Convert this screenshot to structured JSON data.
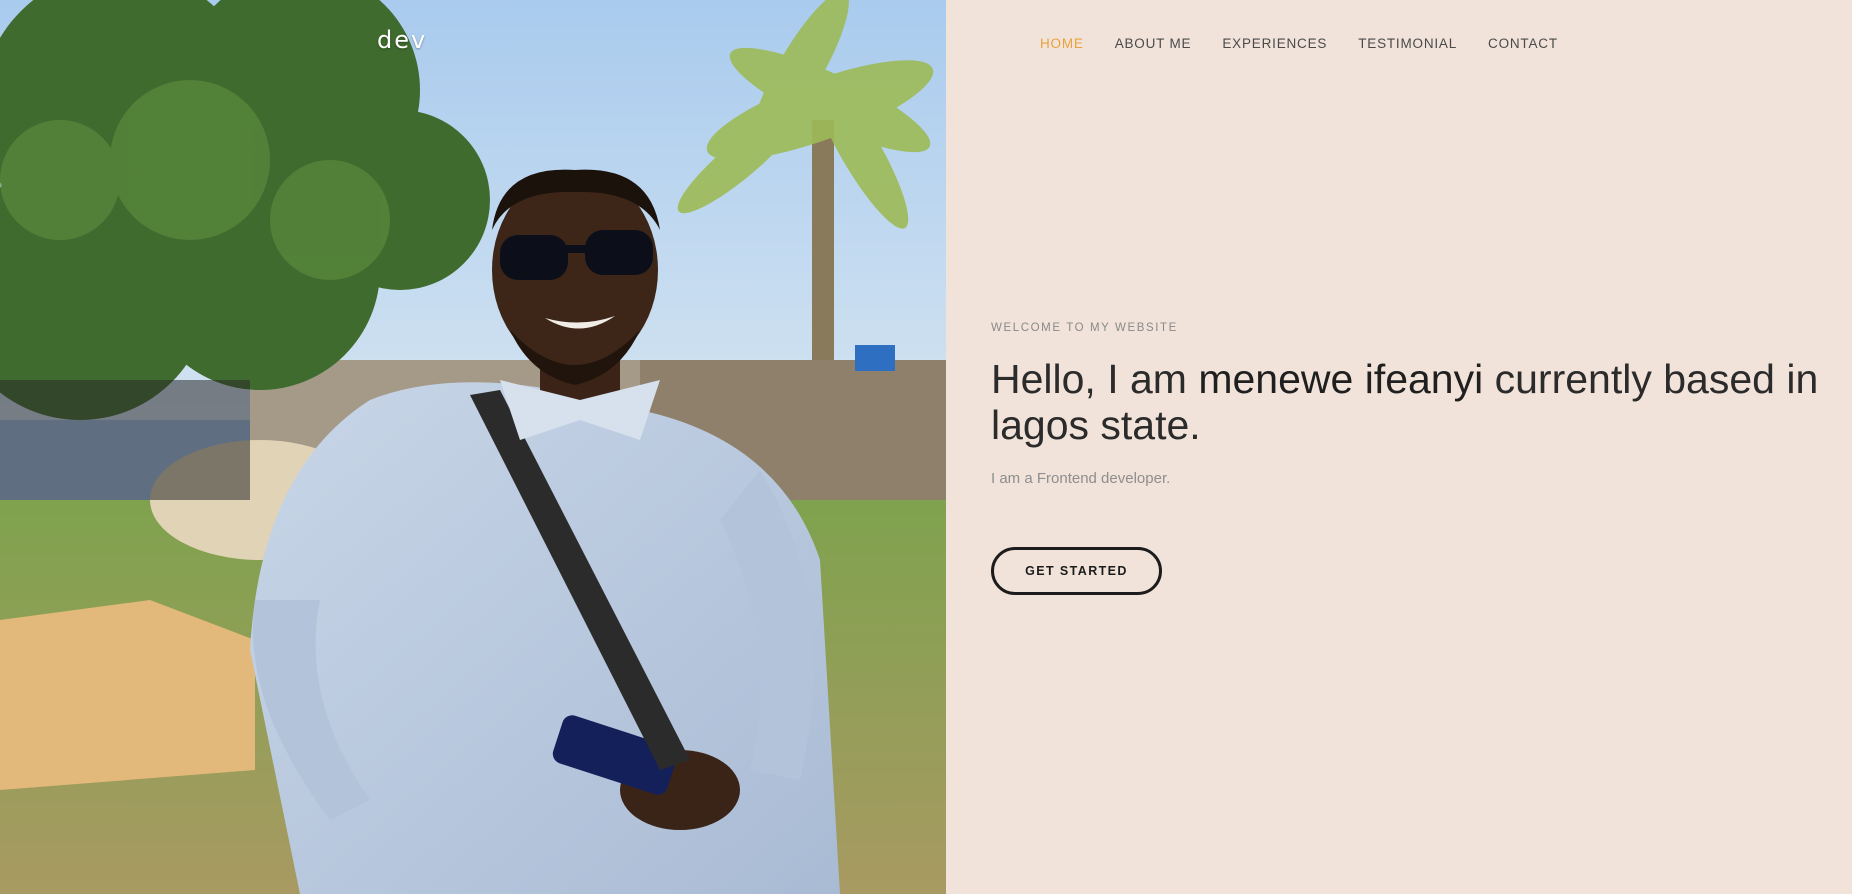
{
  "brand": {
    "logo": "dev"
  },
  "nav": {
    "items": [
      {
        "label": "HOME",
        "active": true
      },
      {
        "label": "ABOUT ME",
        "active": false
      },
      {
        "label": "EXPERIENCES",
        "active": false
      },
      {
        "label": "TESTIMONIAL",
        "active": false
      },
      {
        "label": "CONTACT",
        "active": false
      }
    ],
    "active_color": "#e8a33d"
  },
  "hero": {
    "eyebrow": "WELCOME TO MY WEBSITE",
    "headline_prefix": "Hello, I am ",
    "headline_name": "menewe ifeanyi",
    "headline_suffix": " currently based in lagos state.",
    "subtitle": "I am a Frontend developer.",
    "cta_label": "GET STARTED"
  },
  "colors": {
    "background": "#f1e3d9",
    "text_dark": "#2b2b2b",
    "text_muted": "#8e8e8e"
  }
}
